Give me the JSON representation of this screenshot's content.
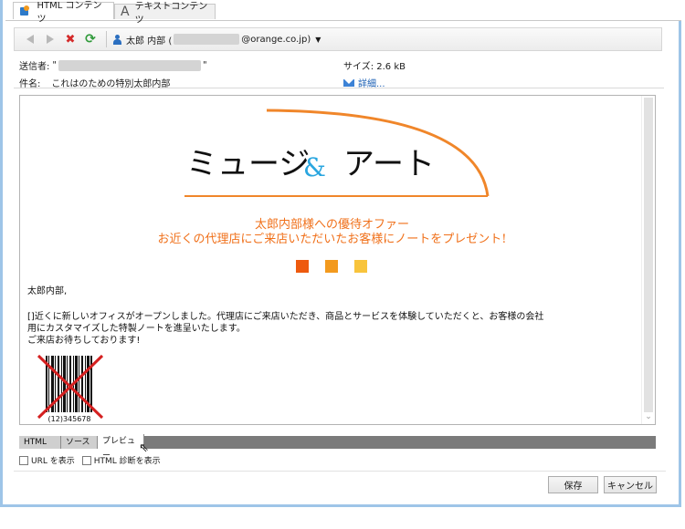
{
  "tabs": [
    {
      "label": "HTML コンテンツ",
      "active": true
    },
    {
      "label": "テキストコンテンツ",
      "active": false
    }
  ],
  "toolbar": {
    "sender_prefix": "太郎 内部 (",
    "sender_suffix": "@orange.co.jp)"
  },
  "header": {
    "sender_label": "送信者:",
    "sender_quote_open": "\"",
    "sender_quote_close": "\"",
    "subject_label": "件名:",
    "subject_value": "これはのための特別太郎内部",
    "size_label": "サイズ:",
    "size_value": "2.6 kB",
    "details_label": "詳細..."
  },
  "preview": {
    "logo_left": "ミュージ",
    "logo_amp": "&",
    "logo_right": "アート",
    "offer_line1": "太郎内部様への優待オファー",
    "offer_line2": "お近くの代理店にご来店いただいたお客様にノートをプレゼント!",
    "squares": [
      "#ee5a0e",
      "#f39a1e",
      "#f8c43c"
    ],
    "greeting": "太郎内部,",
    "paragraph_line1": "[]近くに新しいオフィスがオープンしました。代理店にご来店いただき、商品とサービスを体験していただくと、お客様の会社",
    "paragraph_line2": "用にカスタマイズした特製ノートを進呈いたします。",
    "paragraph_line3": "ご来店お待ちしております!",
    "barcode_text": "(12)345678"
  },
  "view_tabs": [
    {
      "label": "HTML",
      "active": false
    },
    {
      "label": "ソース",
      "active": false
    },
    {
      "label": "プレビュー",
      "active": true
    }
  ],
  "options": {
    "show_url": "URL を表示",
    "show_html_diag": "HTML 診断を表示"
  },
  "buttons": {
    "save": "保存",
    "cancel": "キャンセル"
  },
  "colors": {
    "accent_orange": "#f0701a",
    "amp_blue": "#2aa6df"
  }
}
